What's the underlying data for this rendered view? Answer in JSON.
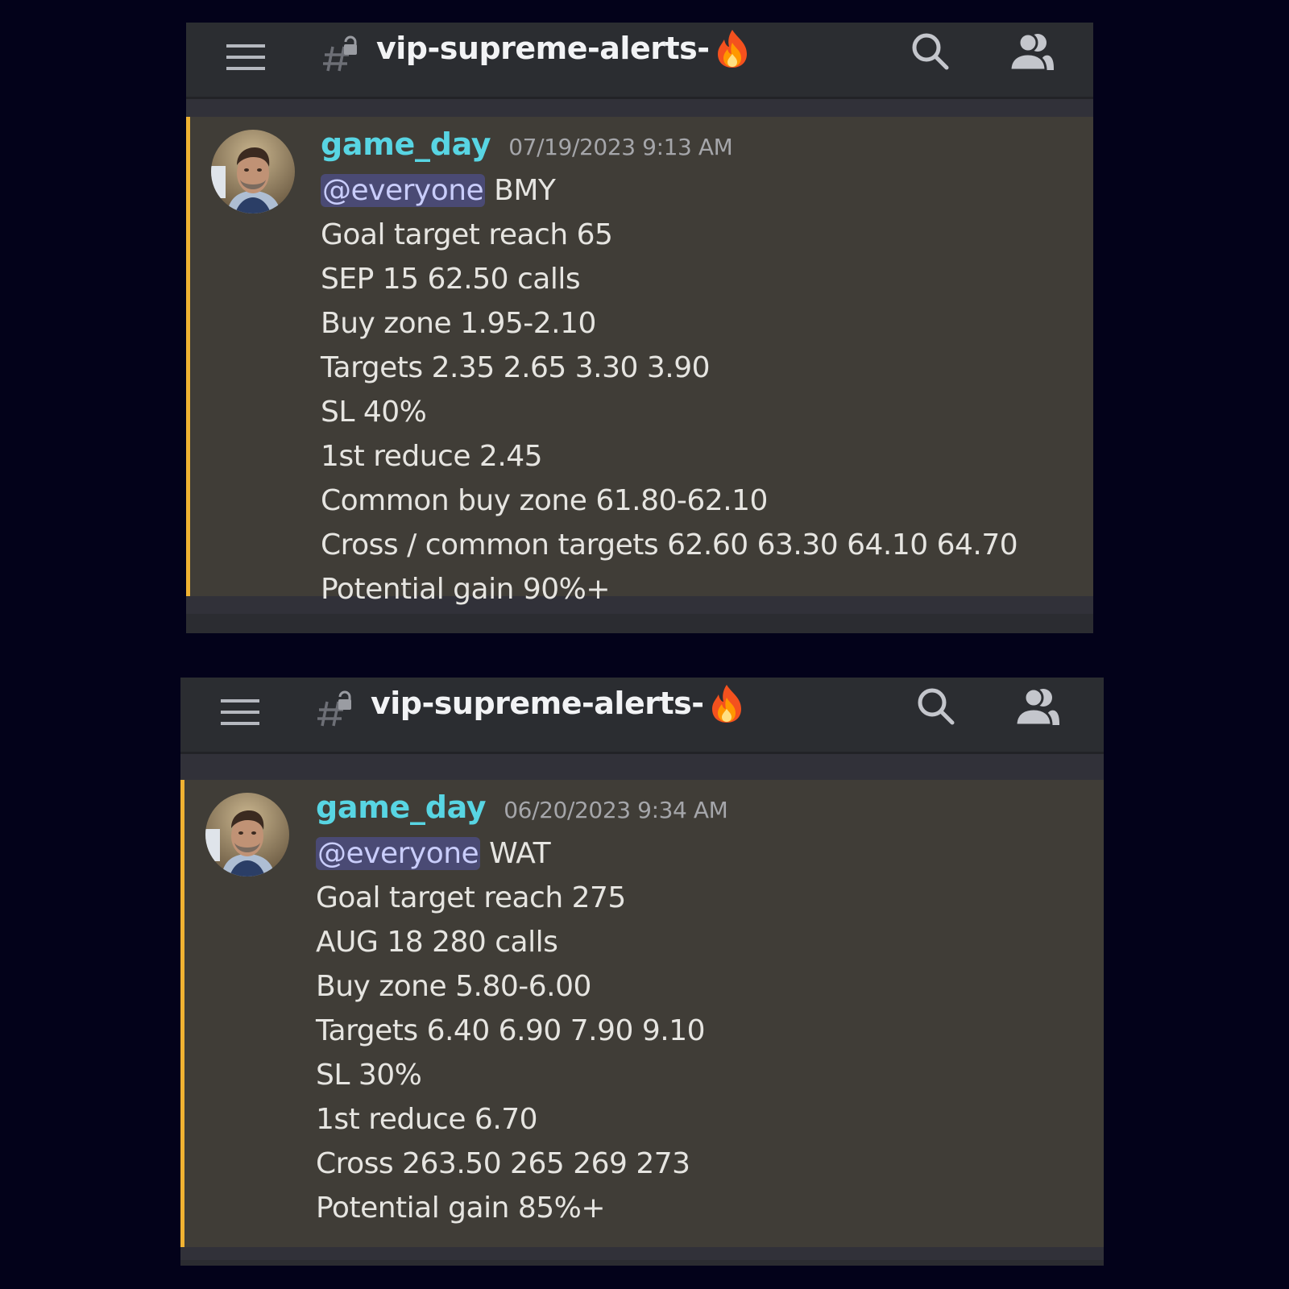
{
  "colors": {
    "page_background": "#03021a",
    "header_background": "#2b2d31",
    "message_background": "#403d37",
    "highlight_bar": "#f0b232",
    "username": "#58d5e3",
    "mention_background": "#4a4a74",
    "mention_text": "#c9cdfb",
    "body_text": "#e6e5e1"
  },
  "icons": {
    "menu": "hamburger-menu-icon",
    "channel": "locked-hashtag-icon",
    "channel_suffix": "fire-emoji",
    "search": "search-icon",
    "members": "members-icon"
  },
  "screens": [
    {
      "header": {
        "channel_name": "vip-supreme-alerts-",
        "channel_emoji": "🔥"
      },
      "message": {
        "author": "game_day",
        "timestamp": "07/19/2023 9:13 AM",
        "mention": "@everyone",
        "ticker": "BMY",
        "lines": [
          "Goal target reach 65",
          "SEP 15 62.50 calls",
          "Buy zone 1.95-2.10",
          "Targets 2.35 2.65 3.30 3.90",
          "SL 40%",
          "1st reduce 2.45",
          "Common buy zone 61.80-62.10",
          "Cross / common targets 62.60 63.30 64.10 64.70",
          "Potential gain 90%+"
        ]
      }
    },
    {
      "header": {
        "channel_name": "vip-supreme-alerts-",
        "channel_emoji": "🔥"
      },
      "message": {
        "author": "game_day",
        "timestamp": "06/20/2023 9:34 AM",
        "mention": "@everyone",
        "ticker": "WAT",
        "lines": [
          "Goal target reach 275",
          "AUG 18 280 calls",
          "Buy zone 5.80-6.00",
          "Targets 6.40 6.90 7.90 9.10",
          "SL 30%",
          "1st reduce 6.70",
          "Cross 263.50 265 269 273",
          "Potential gain 85%+"
        ]
      }
    }
  ]
}
